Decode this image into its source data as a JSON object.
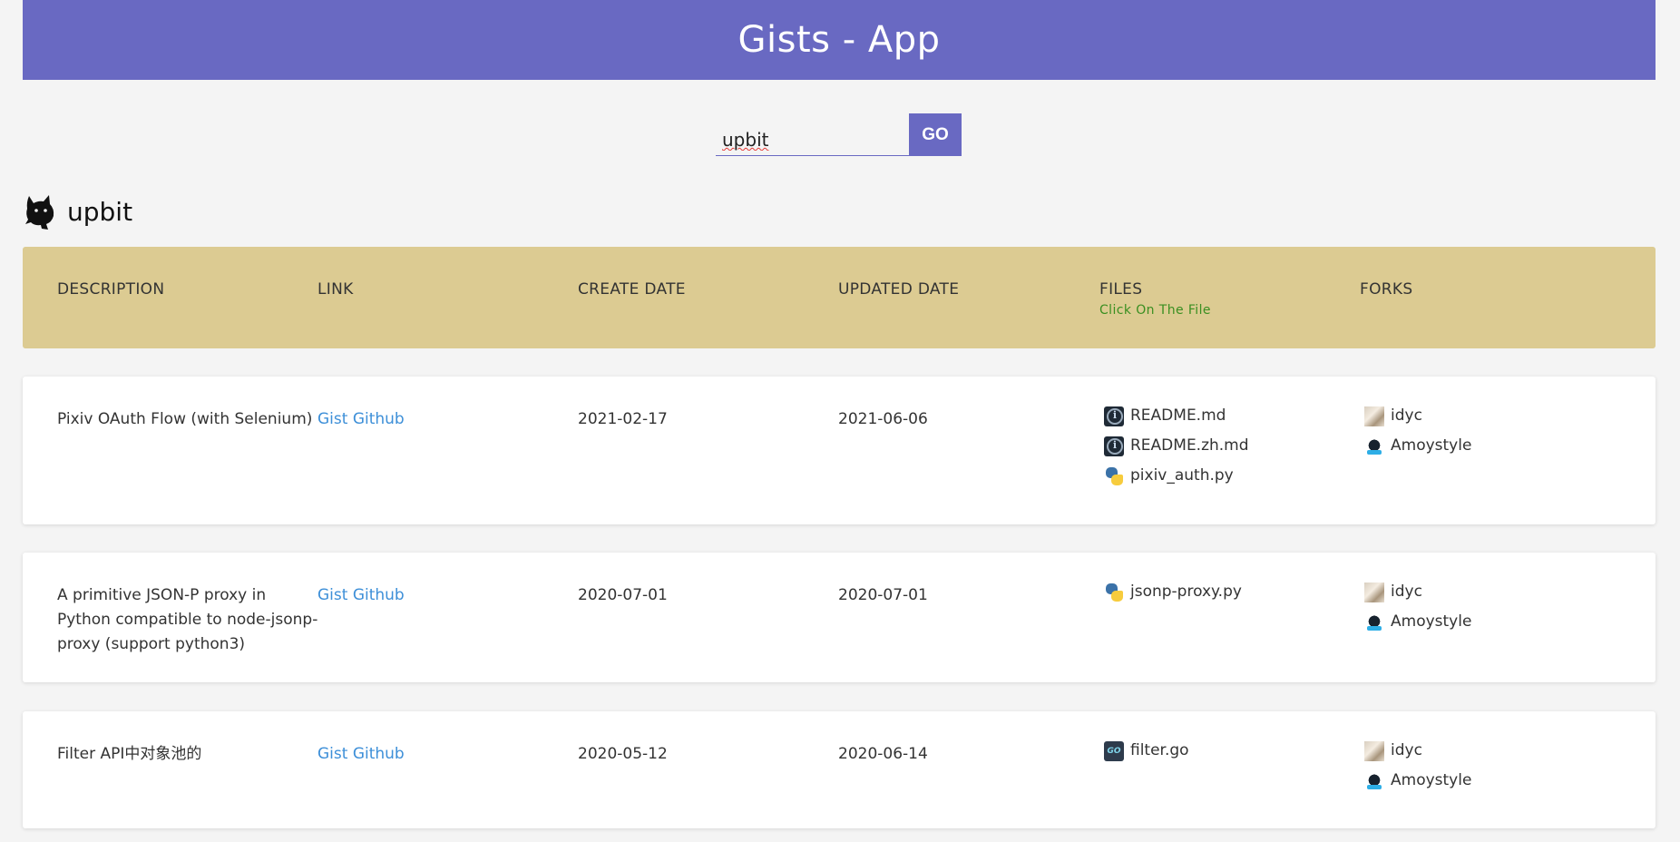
{
  "app": {
    "title": "Gists - App"
  },
  "search": {
    "value": "upbit",
    "button_label": "GO"
  },
  "user": {
    "name": "upbit"
  },
  "table": {
    "headers": {
      "description": "DESCRIPTION",
      "link": "LINK",
      "create_date": "CREATE DATE",
      "updated_date": "UPDATED DATE",
      "files": "FILES",
      "files_hint": "Click On The File",
      "forks": "FORKS"
    },
    "rows": [
      {
        "description": "Pixiv OAuth Flow (with Selenium)",
        "link": "Gist Github",
        "create_date": "2021-02-17",
        "updated_date": "2021-06-06",
        "files": [
          {
            "name": "README.md",
            "icon": "info-icon"
          },
          {
            "name": "README.zh.md",
            "icon": "info-icon"
          },
          {
            "name": "pixiv_auth.py",
            "icon": "python-icon"
          }
        ],
        "forks": [
          {
            "name": "idyc",
            "icon": "avatar-idyc"
          },
          {
            "name": "Amoystyle",
            "icon": "avatar-amoystyle"
          }
        ]
      },
      {
        "description": "A primitive JSON-P proxy in Python compatible to node-jsonp-proxy (support python3)",
        "link": "Gist Github",
        "create_date": "2020-07-01",
        "updated_date": "2020-07-01",
        "files": [
          {
            "name": "jsonp-proxy.py",
            "icon": "python-icon"
          }
        ],
        "forks": [
          {
            "name": "idyc",
            "icon": "avatar-idyc"
          },
          {
            "name": "Amoystyle",
            "icon": "avatar-amoystyle"
          }
        ]
      },
      {
        "description": "Filter API中对象池的",
        "link": "Gist Github",
        "create_date": "2020-05-12",
        "updated_date": "2020-06-14",
        "files": [
          {
            "name": "filter.go",
            "icon": "go-icon"
          }
        ],
        "forks": [
          {
            "name": "idyc",
            "icon": "avatar-idyc"
          },
          {
            "name": "Amoystyle",
            "icon": "avatar-amoystyle"
          }
        ]
      }
    ]
  },
  "colors": {
    "header_bg": "#6969c2",
    "table_head_bg": "#dccb92",
    "link": "#3d8fd8",
    "hint": "#3a8f21"
  }
}
